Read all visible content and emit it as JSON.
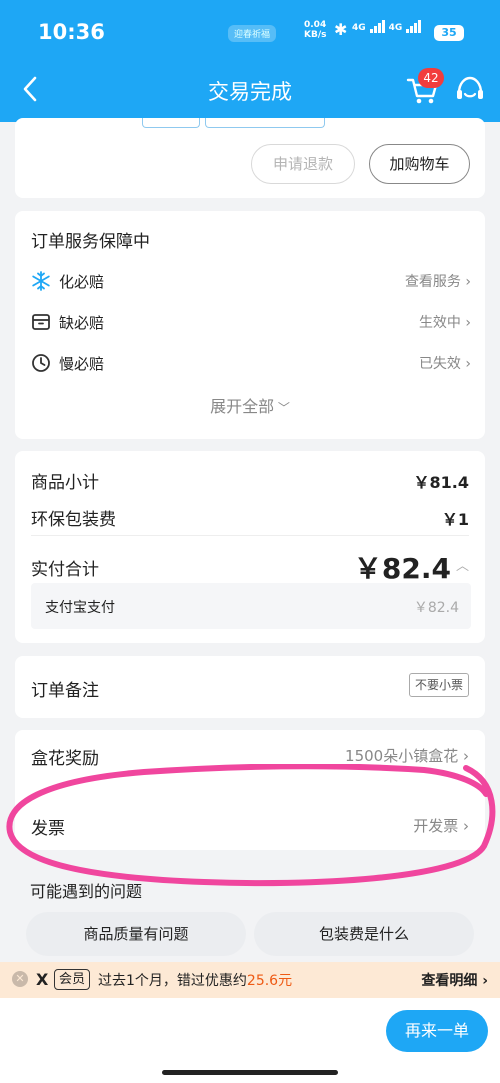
{
  "status_bar": {
    "time": "10:36",
    "pill": "迎春祈福",
    "speed_value": "0.04",
    "speed_unit": "KB/s",
    "net1": "4G",
    "net2": "4G",
    "battery": "35"
  },
  "nav": {
    "title": "交易完成",
    "cart_badge": "42"
  },
  "order_actions": {
    "refund_label": "申请退款",
    "add_cart_label": "加购物车"
  },
  "service": {
    "title": "订单服务保障中",
    "items": [
      {
        "label": "化必赔",
        "status": "查看服务"
      },
      {
        "label": "缺必赔",
        "status": "生效中"
      },
      {
        "label": "慢必赔",
        "status": "已失效"
      }
    ],
    "expand_label": "展开全部"
  },
  "pricing": {
    "subtotal_label": "商品小计",
    "subtotal_value": "￥81.4",
    "packaging_label": "环保包装费",
    "packaging_value": "￥1",
    "total_label": "实付合计",
    "total_value": "￥82.4",
    "payment_method": "支付宝支付",
    "payment_value": "￥82.4"
  },
  "remark": {
    "label": "订单备注",
    "tag": "不要小票"
  },
  "reward": {
    "label": "盒花奖励",
    "value": "1500朵小镇盒花"
  },
  "invoice": {
    "label": "发票",
    "action": "开发票"
  },
  "faq": {
    "title": "可能遇到的问题",
    "items": [
      "商品质量有问题",
      "包装费是什么"
    ]
  },
  "vip_bar": {
    "logo": "X",
    "tag": "会员",
    "text_prefix": "过去1个月，错过优惠约",
    "amount": "25.6元",
    "link": "查看明细"
  },
  "bottom": {
    "again_label": "再来一单"
  },
  "colors": {
    "primary": "#1ea7f5",
    "badge": "#f23d3d",
    "annotation": "#f0469e",
    "vip_amount": "#ee5a14"
  }
}
